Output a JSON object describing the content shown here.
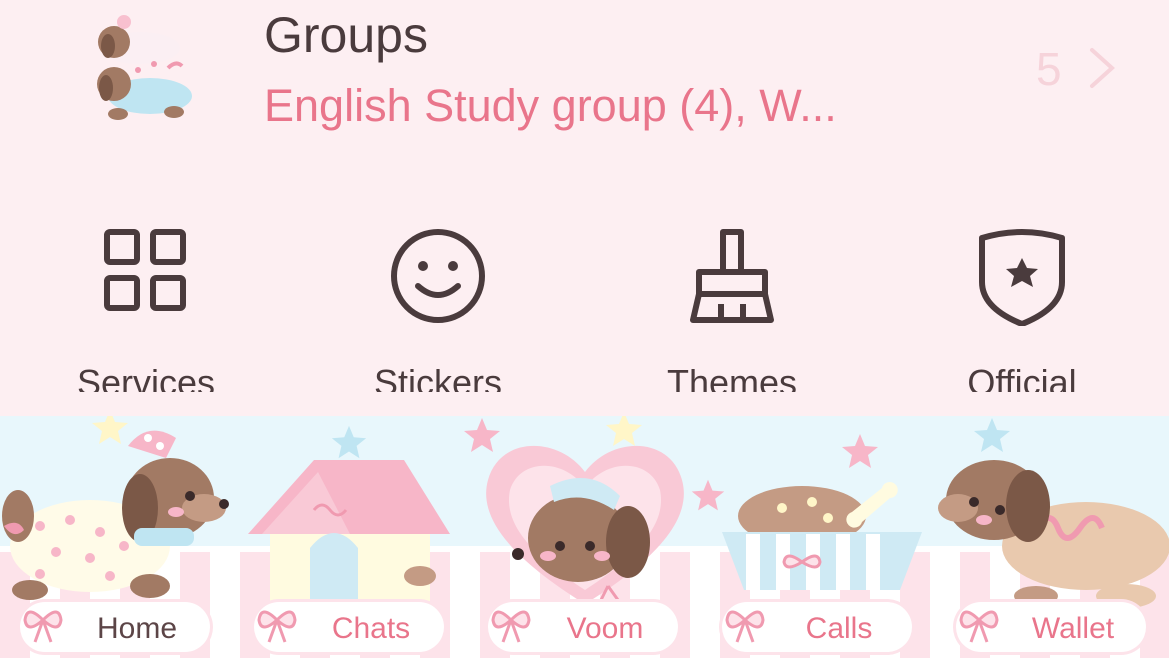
{
  "groups": {
    "title": "Groups",
    "subtitle": "English Study group (4), W...",
    "count": "5",
    "avatar_icon": "puppy-group-avatar",
    "chevron_icon": "chevron-right-icon"
  },
  "shortcuts": [
    {
      "label": "Services",
      "icon": "grid-icon"
    },
    {
      "label": "Stickers",
      "icon": "smiley-icon"
    },
    {
      "label": "Themes",
      "icon": "brush-icon"
    },
    {
      "label": "Official",
      "icon": "shield-star-icon"
    }
  ],
  "tabs": [
    {
      "label": "Home",
      "icon": "puppy-home-icon",
      "active": true
    },
    {
      "label": "Chats",
      "icon": "doghouse-icon",
      "active": false
    },
    {
      "label": "Voom",
      "icon": "puppy-heart-icon",
      "active": false
    },
    {
      "label": "Calls",
      "icon": "food-bowl-icon",
      "active": false
    },
    {
      "label": "Wallet",
      "icon": "puppy-lying-icon",
      "active": false
    }
  ],
  "colors": {
    "background": "#fdeff2",
    "text_dark": "#4a3b3d",
    "accent_pink": "#e9758b",
    "count_faded": "#f6d3da",
    "tabbar_sky": "#e8f7fc"
  }
}
